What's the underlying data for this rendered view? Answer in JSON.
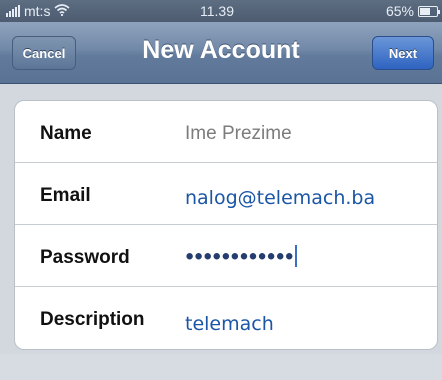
{
  "status_bar": {
    "carrier": "mt:s",
    "time": "11.39",
    "battery_percent": "65%",
    "battery_level": 0.65,
    "wifi_icon": "wifi-icon",
    "signal_icon": "signal-icon"
  },
  "nav": {
    "title": "New Account",
    "cancel_label": "Cancel",
    "next_label": "Next"
  },
  "form": {
    "rows": [
      {
        "label": "Name",
        "value": "Ime Prezime",
        "is_placeholder": true
      },
      {
        "label": "Email",
        "value": "nalog@telemach.ba"
      },
      {
        "label": "Password",
        "value": "●●●●●●●●●●●●"
      },
      {
        "label": "Description",
        "value": "telemach"
      }
    ]
  },
  "colors": {
    "nav_bar": "#6f86a5",
    "next_button": "#3a6fc6",
    "value_text": "#1b55a6"
  }
}
